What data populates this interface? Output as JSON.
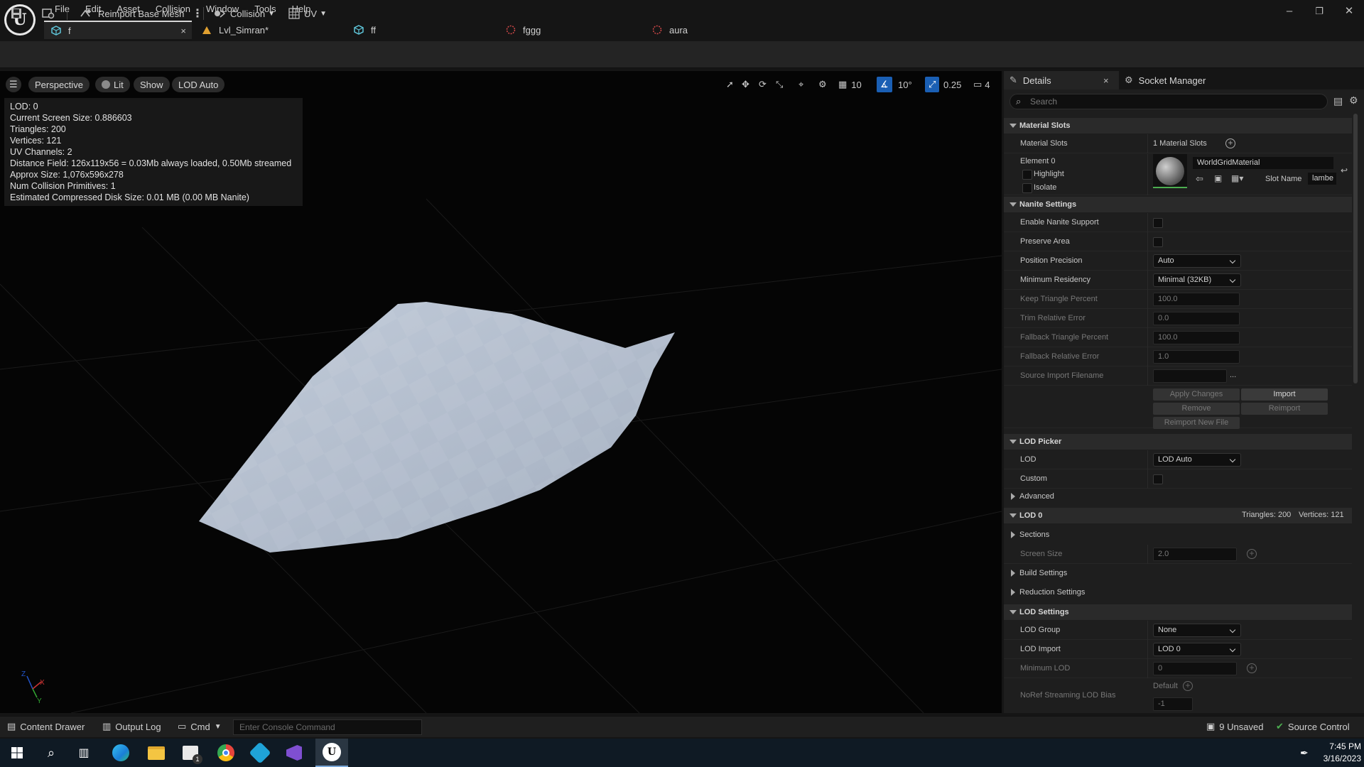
{
  "menu": [
    "File",
    "Edit",
    "Asset",
    "Collision",
    "Window",
    "Tools",
    "Help"
  ],
  "window_controls": {
    "minimize": "–",
    "restore": "❐",
    "close": "✕"
  },
  "tabs": [
    {
      "label": "f",
      "active": true,
      "close": "×"
    },
    {
      "label": "Lvl_Simran*"
    },
    {
      "label": "ff"
    },
    {
      "label": "fggg"
    },
    {
      "label": "aura"
    }
  ],
  "toolbar": {
    "reimport": "Reimport Base Mesh",
    "collision": "Collision",
    "uv": "UV"
  },
  "viewport": {
    "perspective": "Perspective",
    "lit": "Lit",
    "show": "Show",
    "lod_auto": "LOD Auto",
    "grid_size": "10",
    "angle": "10°",
    "scale": "0.25",
    "camera_speed": "4",
    "stats": [
      "LOD:  0",
      "Current Screen Size:  0.886603",
      "Triangles:  200",
      "Vertices:  121",
      "UV Channels:  2",
      "Distance Field:  126x119x56 = 0.03Mb always loaded, 0.50Mb streamed",
      "Approx Size: 1,076x596x278",
      "Num Collision Primitives:  1",
      "Estimated Compressed Disk Size: 0.01 MB (0.00 MB Nanite)"
    ],
    "axis_x": "X",
    "axis_y": "Y",
    "axis_z": "Z"
  },
  "details": {
    "tab_details": "Details",
    "tab_close": "×",
    "tab_socket": "Socket Manager",
    "search_placeholder": "Search",
    "material_slots": {
      "header": "Material Slots",
      "label": "Material Slots",
      "value": "1 Material Slots",
      "element": "Element 0",
      "highlight": "Highlight",
      "isolate": "Isolate",
      "material": "WorldGridMaterial",
      "slot_name_label": "Slot Name",
      "slot_name": "lambe"
    },
    "nanite": {
      "header": "Nanite Settings",
      "enable": "Enable Nanite Support",
      "preserve": "Preserve Area",
      "pos_precision": "Position Precision",
      "pos_precision_val": "Auto",
      "min_residency": "Minimum Residency",
      "min_residency_val": "Minimal (32KB)",
      "keep_tri": "Keep Triangle Percent",
      "keep_tri_val": "100.0",
      "trim_err": "Trim Relative Error",
      "trim_err_val": "0.0",
      "fallback_tri": "Fallback Triangle Percent",
      "fallback_tri_val": "100.0",
      "fallback_err": "Fallback Relative Error",
      "fallback_err_val": "1.0",
      "source_file": "Source Import Filename",
      "more": "...",
      "apply": "Apply Changes",
      "import": "Import",
      "remove": "Remove",
      "reimport": "Reimport",
      "reimport_new": "Reimport New File"
    },
    "lod_picker": {
      "header": "LOD Picker",
      "lod": "LOD",
      "lod_val": "LOD Auto",
      "custom": "Custom",
      "advanced": "Advanced"
    },
    "lod0": {
      "header": "LOD 0",
      "triangles": "Triangles: 200",
      "vertices": "Vertices: 121",
      "sections": "Sections",
      "screen_size": "Screen Size",
      "screen_size_val": "2.0",
      "build": "Build Settings",
      "reduction": "Reduction Settings"
    },
    "lod_settings": {
      "header": "LOD Settings",
      "group": "LOD Group",
      "group_val": "None",
      "import": "LOD Import",
      "import_val": "LOD 0",
      "min_lod": "Minimum LOD",
      "min_lod_val": "0",
      "noref": "NoRef Streaming LOD Bias",
      "default": "Default",
      "noref_val": "-1"
    }
  },
  "bottom": {
    "content_drawer": "Content Drawer",
    "output_log": "Output Log",
    "cmd": "Cmd",
    "console_placeholder": "Enter Console Command",
    "unsaved": "9 Unsaved",
    "source_control": "Source Control"
  },
  "taskbar": {
    "time": "7:45 PM",
    "date": "3/16/2023",
    "badge": "1"
  }
}
